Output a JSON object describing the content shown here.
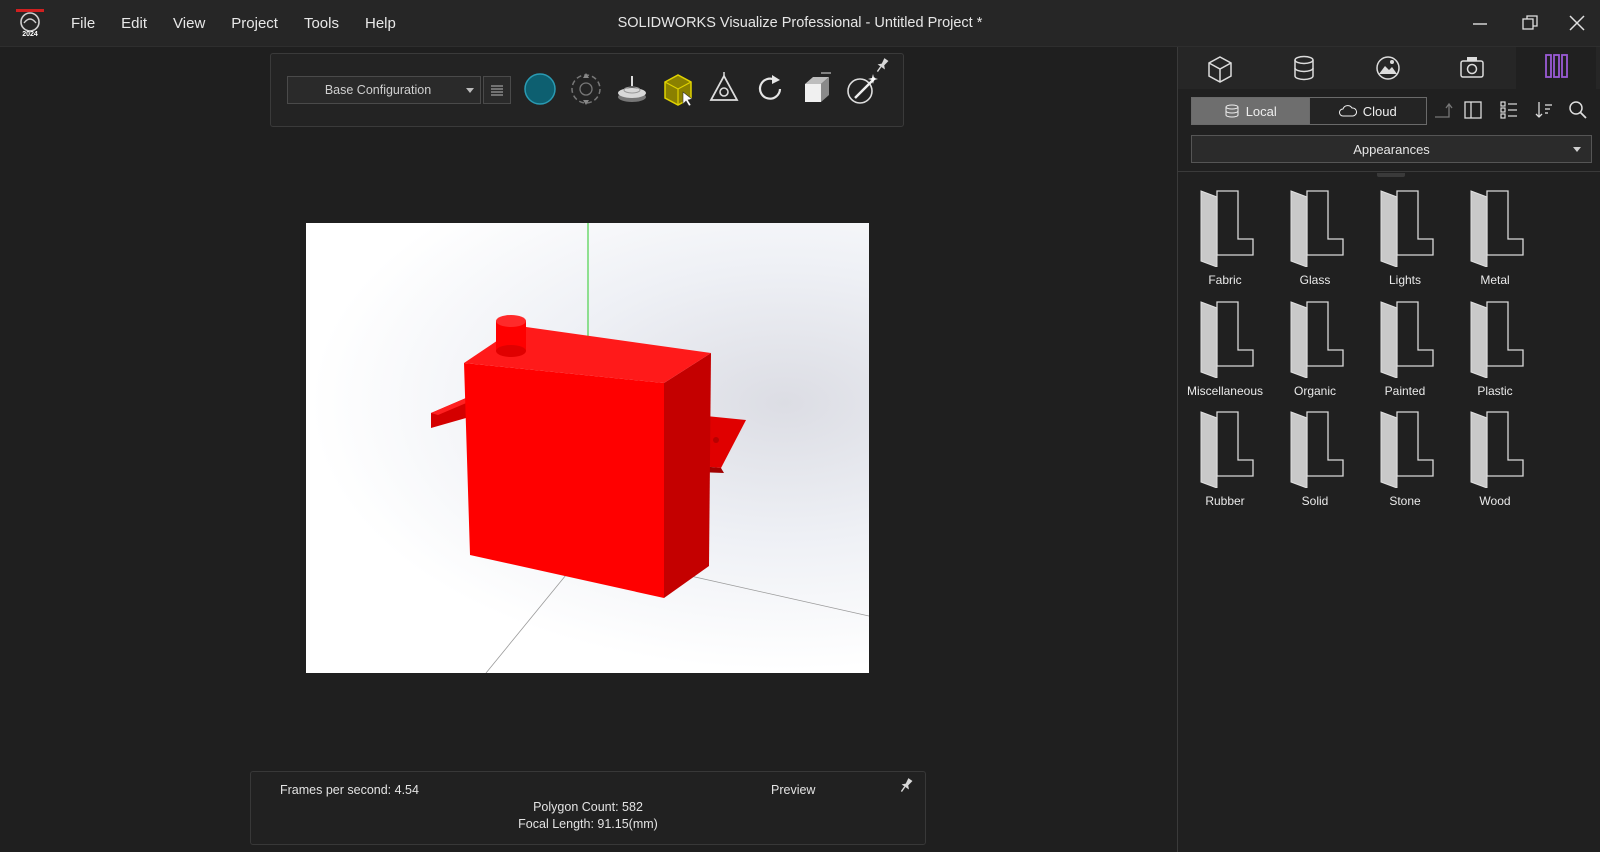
{
  "app": {
    "logo_text": "2024",
    "window_title": "SOLIDWORKS Visualize Professional - Untitled Project *"
  },
  "menu": [
    "File",
    "Edit",
    "View",
    "Project",
    "Tools",
    "Help"
  ],
  "toolbar": {
    "configuration": "Base Configuration",
    "tools": [
      "appearance-sphere-icon",
      "orbit-icon",
      "turntable-icon",
      "select-part-icon",
      "transform-icon",
      "refresh-icon",
      "model-frame-icon",
      "magic-wand-icon"
    ]
  },
  "status": {
    "fps": "Frames per second: 4.54",
    "mode": "Preview",
    "polygons": "Polygon Count: 582",
    "focal": "Focal Length: 91.15(mm)"
  },
  "side_panel": {
    "tabs": [
      "models-icon",
      "appearances-icon",
      "scenes-icon",
      "cameras-icon",
      "libraries-icon"
    ],
    "source_local": "Local",
    "source_cloud": "Cloud",
    "category": "Appearances",
    "folders": [
      "Fabric",
      "Glass",
      "Lights",
      "Metal",
      "Miscellaneous",
      "Organic",
      "Painted",
      "Plastic",
      "Rubber",
      "Solid",
      "Stone",
      "Wood"
    ]
  },
  "colors": {
    "accent_purple": "#9a5bd6",
    "model_red": "#ff0000",
    "teal": "#0d5f70",
    "yellow": "#c8c000"
  }
}
